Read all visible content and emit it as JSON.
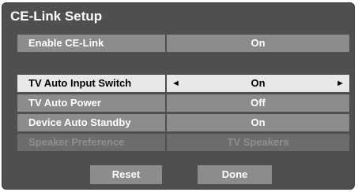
{
  "window": {
    "title": "CE-Link Setup"
  },
  "rows": [
    {
      "label": "Enable CE-Link",
      "value": "On"
    },
    {
      "label": "TV Auto Input Switch",
      "value": "On"
    },
    {
      "label": "TV Auto Power",
      "value": "Off"
    },
    {
      "label": "Device Auto Standby",
      "value": "On"
    },
    {
      "label": "Speaker Preference",
      "value": "TV Speakers"
    }
  ],
  "selector": {
    "left_arrow": "◄",
    "right_arrow": "►"
  },
  "buttons": {
    "reset": "Reset",
    "done": "Done"
  }
}
